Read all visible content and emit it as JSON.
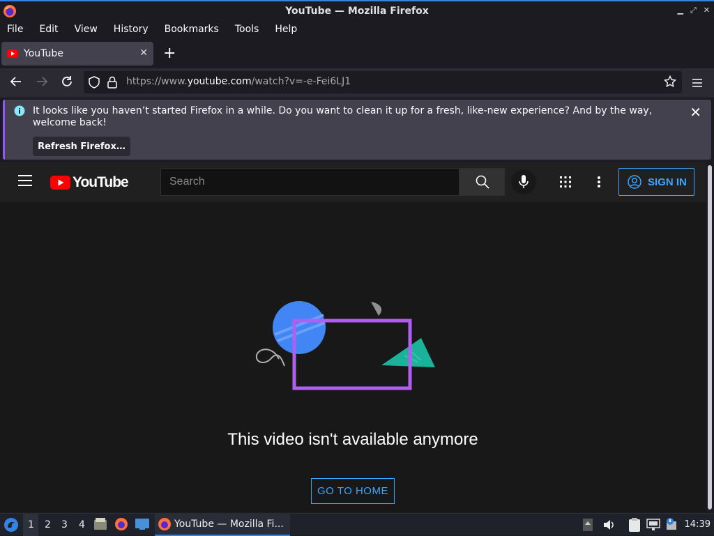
{
  "window": {
    "title": "YouTube — Mozilla Firefox"
  },
  "menu": {
    "items": [
      "File",
      "Edit",
      "View",
      "History",
      "Bookmarks",
      "Tools",
      "Help"
    ]
  },
  "tab": {
    "label": "YouTube"
  },
  "address": {
    "prefix": "https://www.",
    "host": "youtube.com",
    "path": "/watch?v=-e-Fei6LJ1"
  },
  "notification": {
    "text": "It looks like you haven’t started Firefox in a while. Do you want to clean it up for a fresh, like-new experience? And by the way, welcome back!",
    "button_label": "Refresh Firefox…"
  },
  "youtube": {
    "logo_text": "YouTube",
    "search_placeholder": "Search",
    "signin_label": "SIGN IN",
    "message": "This video isn't available anymore",
    "home_button": "GO TO HOME"
  },
  "taskbar": {
    "workspaces": [
      "1",
      "2",
      "3",
      "4"
    ],
    "window_label": "YouTube — Mozilla Fi...",
    "clock": "14:39"
  },
  "colors": {
    "accent": "#3ea6ff",
    "brand_red": "#ff0000",
    "highlight": "#9059ff"
  }
}
